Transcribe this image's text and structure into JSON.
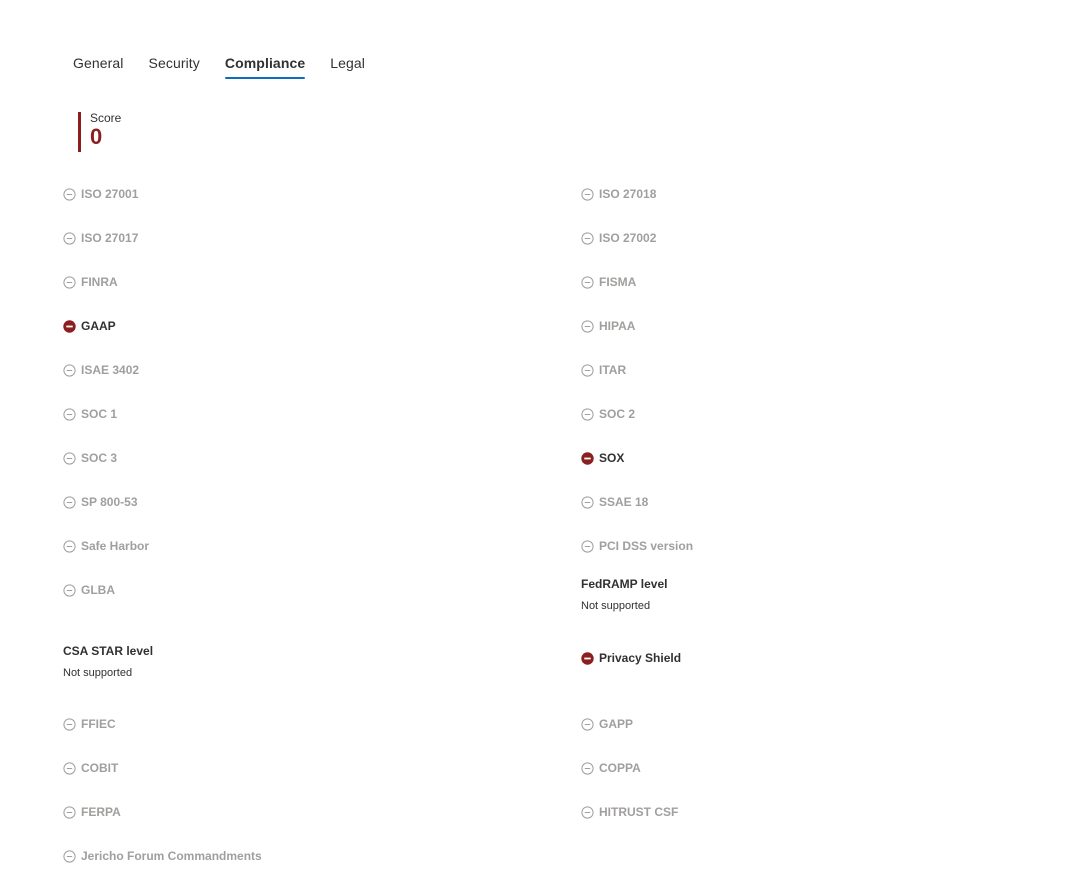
{
  "tabs": [
    {
      "label": "General"
    },
    {
      "label": "Security"
    },
    {
      "label": "Compliance"
    },
    {
      "label": "Legal"
    }
  ],
  "score": {
    "label": "Score",
    "value": "0"
  },
  "left": {
    "iso27001": "ISO 27001",
    "iso27017": "ISO 27017",
    "finra": "FINRA",
    "gaap": "GAAP",
    "isae3402": "ISAE 3402",
    "soc1": "SOC 1",
    "soc3": "SOC 3",
    "sp80053": "SP 800-53",
    "safeharbor": "Safe Harbor",
    "glba": "GLBA",
    "csa_title": "CSA STAR level",
    "csa_value": "Not supported",
    "ffiec": "FFIEC",
    "cobit": "COBIT",
    "ferpa": "FERPA",
    "jericho": "Jericho Forum Commandments"
  },
  "right": {
    "iso27018": "ISO 27018",
    "iso27002": "ISO 27002",
    "fisma": "FISMA",
    "hipaa": "HIPAA",
    "itar": "ITAR",
    "soc2": "SOC 2",
    "sox": "SOX",
    "ssae18": "SSAE 18",
    "pcidss": "PCI DSS version",
    "fedramp_title": "FedRAMP level",
    "fedramp_value": "Not supported",
    "privacyshield": "Privacy Shield",
    "gapp": "GAPP",
    "coppa": "COPPA",
    "hitrust": "HITRUST CSF"
  },
  "icons": {
    "unsupported": "minus-circle-outline-icon",
    "failed": "minus-circle-filled-icon"
  },
  "colors": {
    "accent": "#0f6cbd",
    "danger": "#8b1f1f",
    "muted": "#a19f9d",
    "text": "#323130"
  }
}
